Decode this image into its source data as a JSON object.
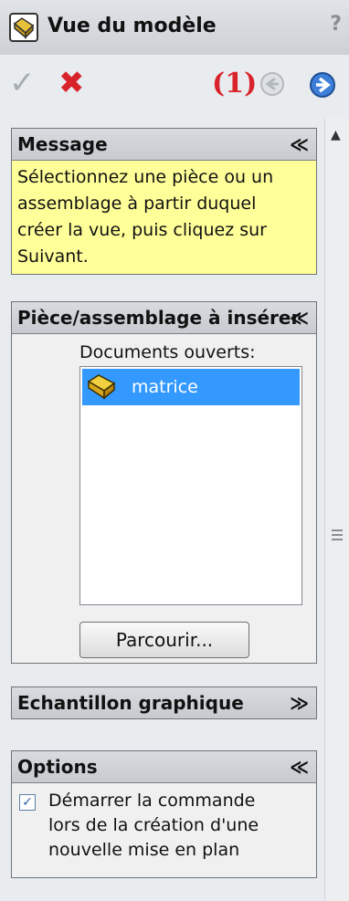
{
  "window": {
    "title": "Vue du modèle",
    "help_symbol": "?"
  },
  "toolbar": {
    "ok_symbol": "✓",
    "cancel_symbol": "✖",
    "step_label": "(1)"
  },
  "sections": {
    "message": {
      "title": "Message",
      "text_lines": [
        "Sélectionnez une pièce ou un",
        "assemblage à partir duquel",
        "créer la vue, puis cliquez sur",
        "Suivant."
      ]
    },
    "insert": {
      "title": "Pièce/assemblage à insérer",
      "open_docs_label": "Documents ouverts:",
      "documents": [
        "matrice"
      ],
      "browse_label": "Parcourir..."
    },
    "preview": {
      "title": "Echantillon graphique"
    },
    "options": {
      "title": "Options",
      "checkbox_lines": [
        "Démarrer la commande",
        "lors de la création d'une",
        "nouvelle mise en plan"
      ],
      "checked": true
    }
  },
  "colors": {
    "accent_red": "#d8232a",
    "message_bg": "#ffff99",
    "selection": "#3399ff"
  }
}
